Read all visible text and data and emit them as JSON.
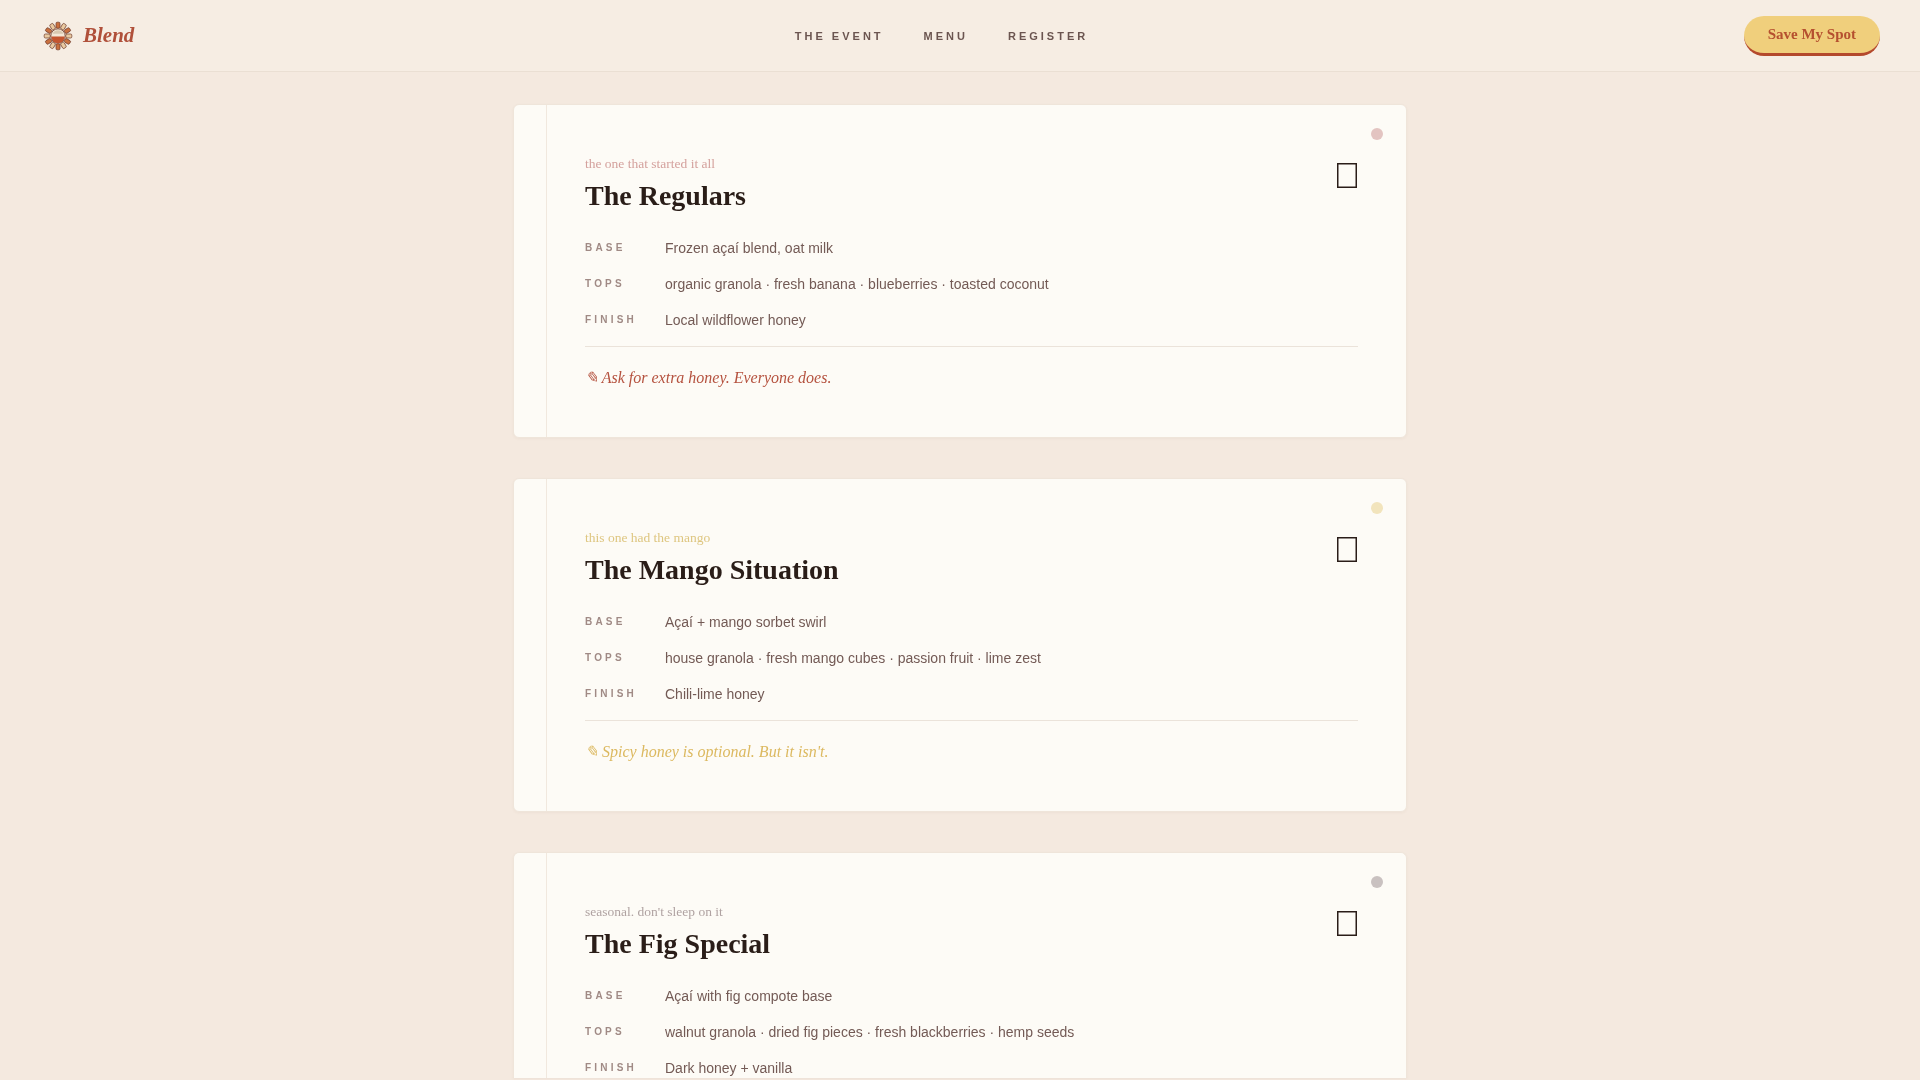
{
  "header": {
    "brand": "Blend",
    "nav": [
      {
        "label": "THE EVENT"
      },
      {
        "label": "MENU"
      },
      {
        "label": "REGISTER"
      }
    ],
    "action": "Save My Spot"
  },
  "cards": [
    {
      "color": "#e3c4c1",
      "tagline": "the one that started it all",
      "title": "The Regulars",
      "rows": [
        {
          "label": "BASE",
          "value": "Frozen açaí blend, oat milk"
        },
        {
          "label": "TOPS",
          "value": "organic granola · fresh banana · blueberries · toasted coconut"
        },
        {
          "label": "FINISH",
          "value": "Local wildflower honey"
        }
      ],
      "note": {
        "text": "✎ Ask for extra honey. Everyone does.",
        "color": "#b5523f"
      }
    },
    {
      "color": "#f2e4bc",
      "tagline": "this one had the mango",
      "title": "The Mango Situation",
      "rows": [
        {
          "label": "BASE",
          "value": "Açaí + mango sorbet swirl"
        },
        {
          "label": "TOPS",
          "value": "house granola · fresh mango cubes · passion fruit · lime zest"
        },
        {
          "label": "FINISH",
          "value": "Chili-lime honey"
        }
      ],
      "note": {
        "text": "✎ Spicy honey is optional. But it isn't.",
        "color": "#dcb960"
      }
    },
    {
      "color": "#c9c1c0",
      "tagline": "seasonal. don't sleep on it",
      "title": "The Fig Special",
      "rows": [
        {
          "label": "BASE",
          "value": "Açaí with fig compote base"
        },
        {
          "label": "TOPS",
          "value": "walnut granola · dried fig pieces · fresh blackberries · hemp seeds"
        },
        {
          "label": "FINISH",
          "value": "Dark honey + vanilla"
        }
      ]
    }
  ]
}
